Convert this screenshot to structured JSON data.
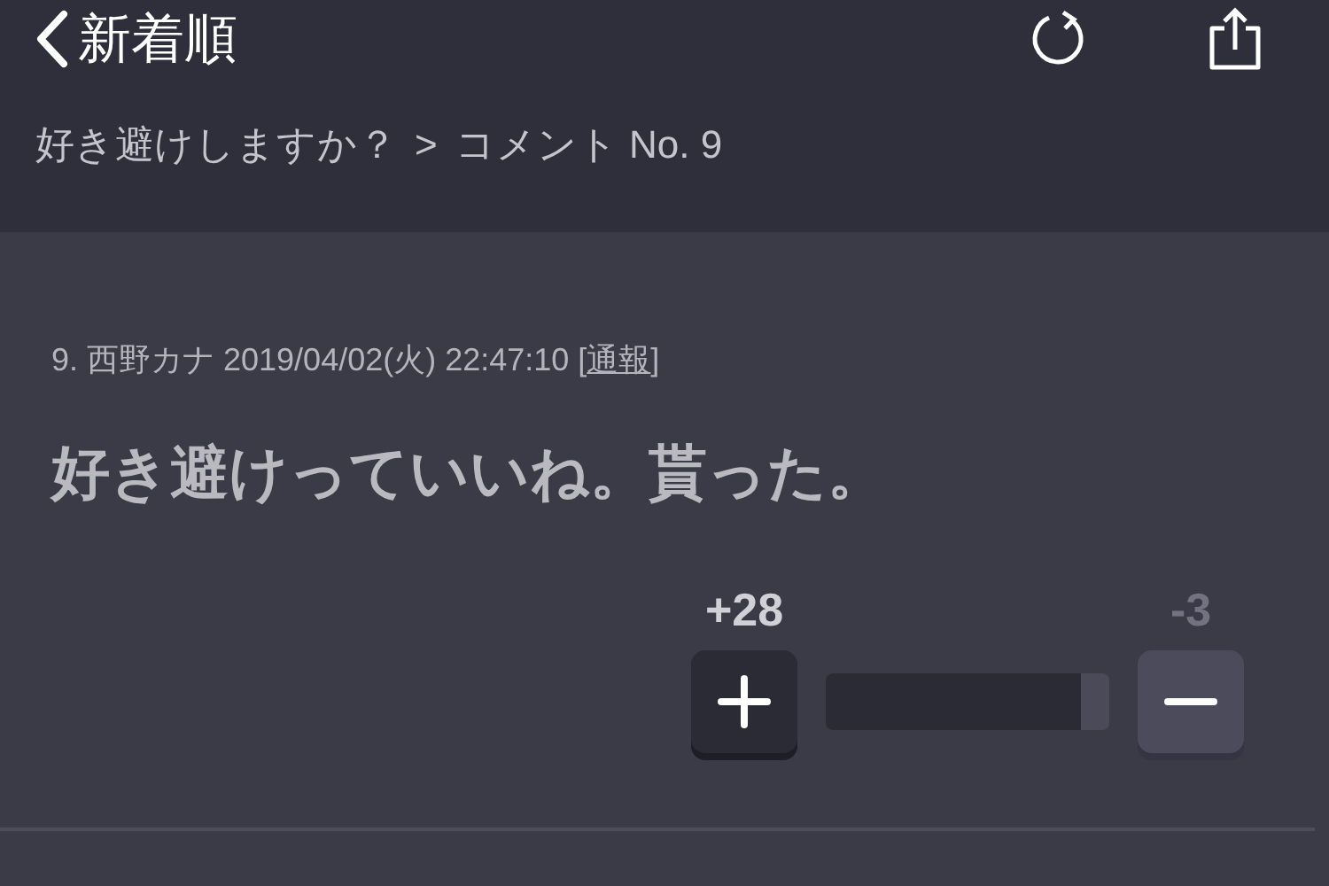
{
  "nav": {
    "title": "新着順"
  },
  "breadcrumb": {
    "parent": "好き避けしますか？",
    "separator": ">",
    "current": "コメント No. 9"
  },
  "comment": {
    "meta": "9. 西野カナ 2019/04/02(火) 22:47:10 [",
    "report": "通報",
    "meta_end": "]",
    "body": "好き避けっていいね。貰った。"
  },
  "votes": {
    "plus": "+28",
    "minus": "-3",
    "level": 0.9
  }
}
